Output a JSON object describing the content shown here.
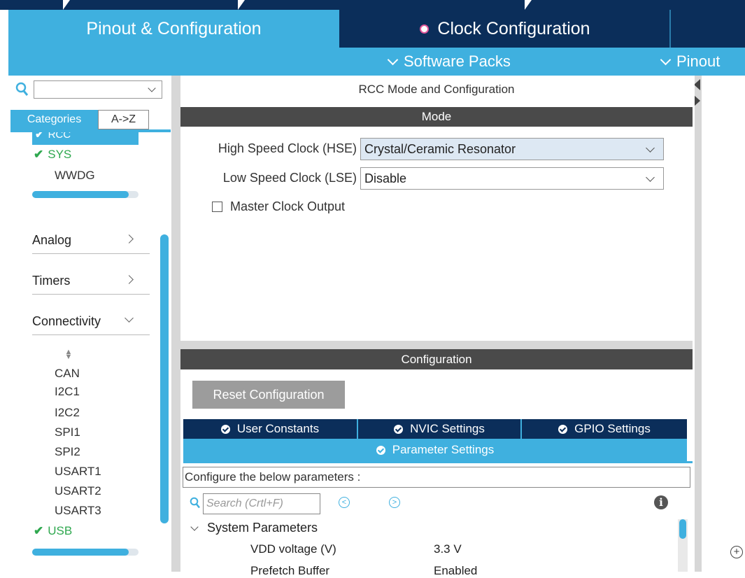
{
  "tabs": {
    "pinout_config": "Pinout & Configuration",
    "clock_config": "Clock Configuration"
  },
  "subbar": {
    "software_packs": "Software Packs",
    "pinout": "Pinout"
  },
  "left": {
    "search_value": "",
    "categories_tab": "Categories",
    "az_tab": "A->Z",
    "system_core_items": [
      {
        "label": "RCC",
        "checked": true,
        "selected": true
      },
      {
        "label": "SYS",
        "checked": true
      },
      {
        "label": "WWDG",
        "checked": false
      }
    ],
    "categories": [
      {
        "label": "Analog",
        "expanded": false
      },
      {
        "label": "Timers",
        "expanded": false
      },
      {
        "label": "Connectivity",
        "expanded": true
      }
    ],
    "connectivity_items": [
      {
        "label": "CAN",
        "checked": false
      },
      {
        "label": "I2C1",
        "checked": false
      },
      {
        "label": "I2C2",
        "checked": false
      },
      {
        "label": "SPI1",
        "checked": false
      },
      {
        "label": "SPI2",
        "checked": false
      },
      {
        "label": "USART1",
        "checked": false
      },
      {
        "label": "USART2",
        "checked": false
      },
      {
        "label": "USART3",
        "checked": false
      },
      {
        "label": "USB",
        "checked": true
      }
    ]
  },
  "center": {
    "title": "RCC Mode and Configuration",
    "mode_header": "Mode",
    "hse_label": "High Speed Clock (HSE)",
    "hse_value": "Crystal/Ceramic Resonator",
    "lse_label": "Low Speed Clock (LSE)",
    "lse_value": "Disable",
    "mco_label": "Master Clock Output",
    "mco_checked": false,
    "config_header": "Configuration",
    "reset_button": "Reset Configuration",
    "config_tabs": [
      "User Constants",
      "NVIC Settings",
      "GPIO Settings"
    ],
    "active_tab": "Parameter Settings",
    "param_description": "Configure the below parameters :",
    "param_search_placeholder": "Search (Crtl+F)",
    "section": "System Parameters",
    "parameters": [
      {
        "name": "VDD voltage (V)",
        "value": "3.3 V"
      },
      {
        "name": "Prefetch Buffer",
        "value": "Enabled"
      }
    ]
  },
  "colors": {
    "navy": "#0b2e5a",
    "accent_blue": "#3fb0df",
    "header_gray": "#4a4a4a",
    "check_green": "#2fa84f",
    "clock_dot": "#e0569a"
  },
  "icons": {
    "search": "search-icon",
    "info": "info-icon",
    "zoom_in": "zoom-in-icon"
  }
}
